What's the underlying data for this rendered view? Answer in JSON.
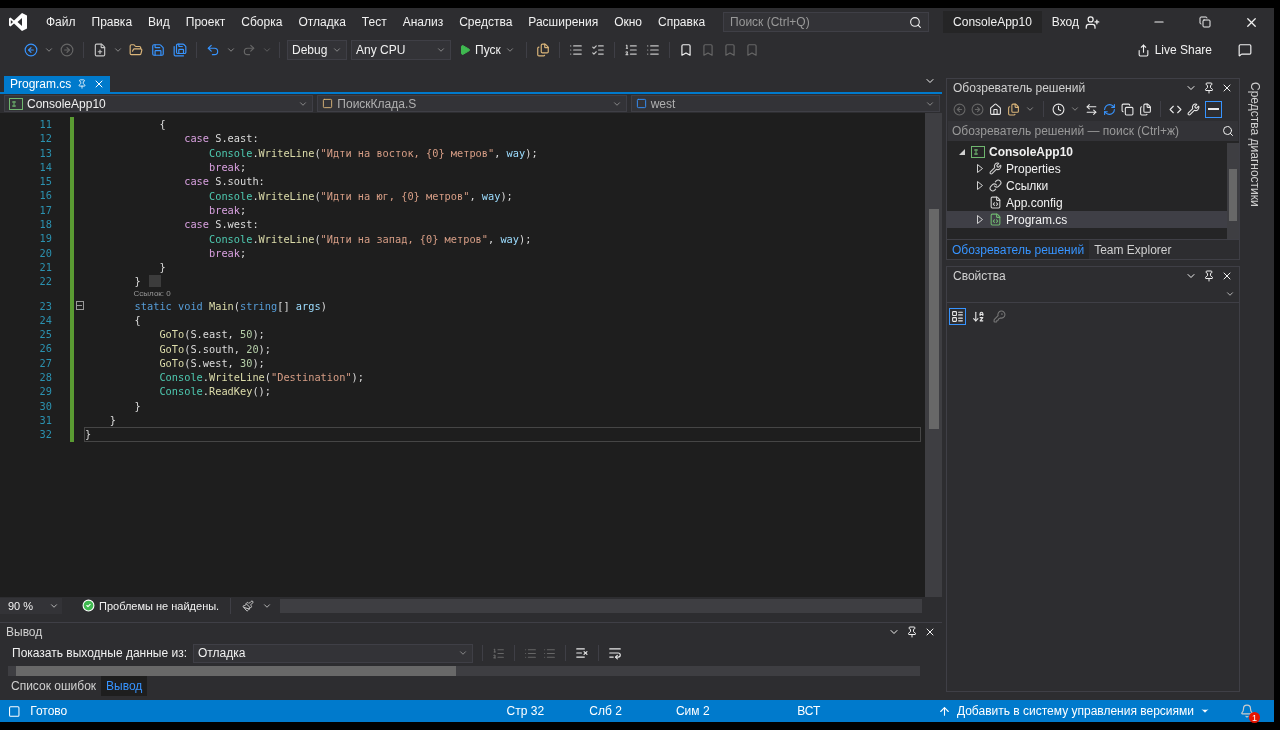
{
  "title_bar": {
    "menu": [
      "Файл",
      "Правка",
      "Вид",
      "Проект",
      "Сборка",
      "Отладка",
      "Тест",
      "Анализ",
      "Средства",
      "Расширения",
      "Окно",
      "Справка"
    ],
    "search": {
      "placeholder": "Поиск (Ctrl+Q)"
    },
    "solution_name": "ConsoleApp10",
    "sign_in": "Вход"
  },
  "toolbar": {
    "configuration": "Debug",
    "platform": "Any CPU",
    "start": "Пуск",
    "live_share": "Live Share"
  },
  "editor": {
    "tabs": [
      {
        "label": "Program.cs",
        "selected": true
      }
    ],
    "nav": {
      "project": "ConsoleApp10",
      "type": "ПоискКлада.S",
      "member": "west"
    },
    "lines": [
      {
        "n": "11",
        "changed": true,
        "current": false,
        "tokens": [
          {
            "t": "            {",
            "kind": "plain"
          }
        ]
      },
      {
        "n": "12",
        "changed": true,
        "current": false,
        "tokens": [
          {
            "t": "                case",
            "kind": "control"
          },
          {
            "t": " S.east:",
            "kind": "plain"
          }
        ]
      },
      {
        "n": "13",
        "changed": true,
        "current": false,
        "tokens": [
          {
            "t": "                    Console",
            "kind": "type"
          },
          {
            "t": ".",
            "kind": "plain"
          },
          {
            "t": "WriteLine",
            "kind": "method"
          },
          {
            "t": "(",
            "kind": "plain"
          },
          {
            "t": "\"Идти на восток, {0} метров\"",
            "kind": "string"
          },
          {
            "t": ", ",
            "kind": "plain"
          },
          {
            "t": "way",
            "kind": "param"
          },
          {
            "t": ");",
            "kind": "plain"
          }
        ]
      },
      {
        "n": "14",
        "changed": true,
        "current": false,
        "tokens": [
          {
            "t": "                    break",
            "kind": "control"
          },
          {
            "t": ";",
            "kind": "plain"
          }
        ]
      },
      {
        "n": "15",
        "changed": true,
        "current": false,
        "tokens": [
          {
            "t": "                case",
            "kind": "control"
          },
          {
            "t": " S.south:",
            "kind": "plain"
          }
        ]
      },
      {
        "n": "16",
        "changed": true,
        "current": false,
        "tokens": [
          {
            "t": "                    Console",
            "kind": "type"
          },
          {
            "t": ".",
            "kind": "plain"
          },
          {
            "t": "WriteLine",
            "kind": "method"
          },
          {
            "t": "(",
            "kind": "plain"
          },
          {
            "t": "\"Идти на юг, {0} метров\"",
            "kind": "string"
          },
          {
            "t": ", ",
            "kind": "plain"
          },
          {
            "t": "way",
            "kind": "param"
          },
          {
            "t": ");",
            "kind": "plain"
          }
        ]
      },
      {
        "n": "17",
        "changed": true,
        "current": false,
        "tokens": [
          {
            "t": "                    break",
            "kind": "control"
          },
          {
            "t": ";",
            "kind": "plain"
          }
        ]
      },
      {
        "n": "18",
        "changed": true,
        "current": false,
        "tokens": [
          {
            "t": "                case",
            "kind": "control"
          },
          {
            "t": " S.west:",
            "kind": "plain"
          }
        ]
      },
      {
        "n": "19",
        "changed": true,
        "current": false,
        "tokens": [
          {
            "t": "                    Console",
            "kind": "type"
          },
          {
            "t": ".",
            "kind": "plain"
          },
          {
            "t": "WriteLine",
            "kind": "method"
          },
          {
            "t": "(",
            "kind": "plain"
          },
          {
            "t": "\"Идти на запад, {0} метров\"",
            "kind": "string"
          },
          {
            "t": ", ",
            "kind": "plain"
          },
          {
            "t": "way",
            "kind": "param"
          },
          {
            "t": ");",
            "kind": "plain"
          }
        ]
      },
      {
        "n": "20",
        "changed": true,
        "current": false,
        "tokens": [
          {
            "t": "                    break",
            "kind": "control"
          },
          {
            "t": ";",
            "kind": "plain"
          }
        ]
      },
      {
        "n": "21",
        "changed": true,
        "current": false,
        "tokens": [
          {
            "t": "            }",
            "kind": "plain"
          }
        ]
      },
      {
        "n": "22",
        "changed": true,
        "current": false,
        "hint": true,
        "tokens": [
          {
            "t": "        }",
            "kind": "plain"
          }
        ]
      },
      {
        "n": "23",
        "changed": true,
        "current": false,
        "fold": true,
        "codelens": "Ссылок: 0",
        "tokens": [
          {
            "t": "        static",
            "kind": "keyword"
          },
          {
            "t": " void",
            "kind": "keyword"
          },
          {
            "t": " Main",
            "kind": "method"
          },
          {
            "t": "(",
            "kind": "plain"
          },
          {
            "t": "string",
            "kind": "keyword"
          },
          {
            "t": "[] ",
            "kind": "plain"
          },
          {
            "t": "args",
            "kind": "param"
          },
          {
            "t": ")",
            "kind": "plain"
          }
        ]
      },
      {
        "n": "24",
        "changed": true,
        "current": false,
        "tokens": [
          {
            "t": "        {",
            "kind": "plain"
          }
        ]
      },
      {
        "n": "25",
        "changed": true,
        "current": false,
        "tokens": [
          {
            "t": "            GoTo",
            "kind": "method"
          },
          {
            "t": "(S.east, ",
            "kind": "plain"
          },
          {
            "t": "50",
            "kind": "number"
          },
          {
            "t": ");",
            "kind": "plain"
          }
        ]
      },
      {
        "n": "26",
        "changed": true,
        "current": false,
        "tokens": [
          {
            "t": "            GoTo",
            "kind": "method"
          },
          {
            "t": "(S.south, ",
            "kind": "plain"
          },
          {
            "t": "20",
            "kind": "number"
          },
          {
            "t": ");",
            "kind": "plain"
          }
        ]
      },
      {
        "n": "27",
        "changed": true,
        "current": false,
        "tokens": [
          {
            "t": "            GoTo",
            "kind": "method"
          },
          {
            "t": "(S.west, ",
            "kind": "plain"
          },
          {
            "t": "30",
            "kind": "number"
          },
          {
            "t": ");",
            "kind": "plain"
          }
        ]
      },
      {
        "n": "28",
        "changed": true,
        "current": false,
        "tokens": [
          {
            "t": "            Console",
            "kind": "type"
          },
          {
            "t": ".",
            "kind": "plain"
          },
          {
            "t": "WriteLine",
            "kind": "method"
          },
          {
            "t": "(",
            "kind": "plain"
          },
          {
            "t": "\"Destination\"",
            "kind": "string"
          },
          {
            "t": ");",
            "kind": "plain"
          }
        ]
      },
      {
        "n": "29",
        "changed": true,
        "current": false,
        "tokens": [
          {
            "t": "            Console",
            "kind": "type"
          },
          {
            "t": ".",
            "kind": "plain"
          },
          {
            "t": "ReadKey",
            "kind": "method"
          },
          {
            "t": "();",
            "kind": "plain"
          }
        ]
      },
      {
        "n": "30",
        "changed": true,
        "current": false,
        "tokens": [
          {
            "t": "        }",
            "kind": "plain"
          }
        ]
      },
      {
        "n": "31",
        "changed": true,
        "current": false,
        "tokens": [
          {
            "t": "    }",
            "kind": "plain"
          }
        ]
      },
      {
        "n": "32",
        "changed": true,
        "current": true,
        "tokens": [
          {
            "t": "}",
            "kind": "plain"
          }
        ]
      }
    ],
    "zoom": "90 %",
    "issues": "Проблемы не найдены."
  },
  "output": {
    "title": "Вывод",
    "source_label": "Показать выходные данные из:",
    "source": "Отладка"
  },
  "bottom_tabs": [
    {
      "label": "Список ошибок",
      "selected": false
    },
    {
      "label": "Вывод",
      "selected": true
    }
  ],
  "solution_explorer": {
    "title": "Обозреватель решений",
    "search": {
      "placeholder": "Обозреватель решений — поиск (Ctrl+ж)"
    },
    "tree": [
      {
        "label": "ConsoleApp10",
        "kind": "project",
        "expanded": true,
        "selected": false,
        "children": [
          {
            "label": "Properties",
            "kind": "properties",
            "expanded": false,
            "selected": false
          },
          {
            "label": "Ссылки",
            "kind": "references",
            "expanded": false,
            "selected": false
          },
          {
            "label": "App.config",
            "kind": "config",
            "selected": false
          },
          {
            "label": "Program.cs",
            "kind": "csharp",
            "expanded": false,
            "selected": true
          }
        ]
      }
    ]
  },
  "right_tabs": [
    {
      "label": "Обозреватель решений",
      "selected": true
    },
    {
      "label": "Team Explorer",
      "selected": false
    }
  ],
  "properties": {
    "title": "Свойства",
    "view_buttons": [
      {
        "selected": true
      },
      {
        "selected": false
      },
      {
        "selected": false
      }
    ]
  },
  "side_tab": "Средства диагностики",
  "status_bar": {
    "message": "Готово",
    "line": "Стр 32",
    "column": "Слб 2",
    "char": "Сим 2",
    "mode": "ВСТ",
    "source_control": "Добавить в систему управления версиями",
    "notifications": "1"
  }
}
